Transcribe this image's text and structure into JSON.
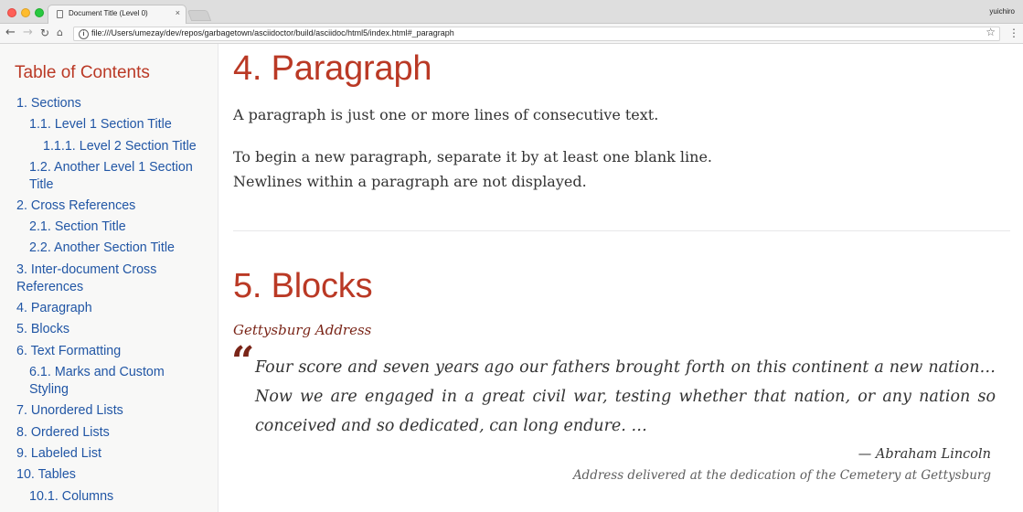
{
  "browser": {
    "tab_title": "Document Title (Level 0)",
    "tab_close": "×",
    "profile_name": "yuichiro",
    "url": "file:///Users/umezay/dev/repos/garbagetown/asciidoctor/build/asciidoc/html5/index.html#_paragraph",
    "icons": {
      "back": "←",
      "forward": "→",
      "reload": "↻",
      "home": "⌂",
      "info": "i",
      "star": "☆",
      "menu": "⋮"
    }
  },
  "toc": {
    "title": "Table of Contents",
    "items": [
      {
        "label": "1. Sections",
        "level": 1
      },
      {
        "label": "1.1. Level 1 Section Title",
        "level": 2
      },
      {
        "label": "1.1.1. Level 2 Section Title",
        "level": 3
      },
      {
        "label": "1.2. Another Level 1 Section Title",
        "level": 2
      },
      {
        "label": "2. Cross References",
        "level": 1
      },
      {
        "label": "2.1. Section Title",
        "level": 2
      },
      {
        "label": "2.2. Another Section Title",
        "level": 2
      },
      {
        "label": "3. Inter-document Cross References",
        "level": 1
      },
      {
        "label": "4. Paragraph",
        "level": 1
      },
      {
        "label": "5. Blocks",
        "level": 1
      },
      {
        "label": "6. Text Formatting",
        "level": 1
      },
      {
        "label": "6.1. Marks and Custom Styling",
        "level": 2
      },
      {
        "label": "7. Unordered Lists",
        "level": 1
      },
      {
        "label": "8. Ordered Lists",
        "level": 1
      },
      {
        "label": "9. Labeled List",
        "level": 1
      },
      {
        "label": "10. Tables",
        "level": 1
      },
      {
        "label": "10.1. Columns",
        "level": 2
      }
    ]
  },
  "content": {
    "section4": {
      "heading": "4. Paragraph",
      "para1": "A paragraph is just one or more lines of consecutive text.",
      "para2_line1": "To begin a new paragraph, separate it by at least one blank line.",
      "para2_line2": "Newlines within a paragraph are not displayed."
    },
    "section5": {
      "heading": "5. Blocks",
      "quote_title": "Gettysburg Address",
      "quote_mark": "“",
      "quote_text": "Four score and seven years ago our fathers brought forth on this continent a new nation… Now we are engaged in a great civil war, testing whether that nation, or any nation so conceived and so dedicated, can long endure. …",
      "attribution": "— Abraham Lincoln",
      "cite_title": "Address delivered at the dedication of the Cemetery at Gettysburg"
    }
  },
  "colors": {
    "heading": "#ba3925",
    "link": "#2156a5",
    "quote_accent": "#7a2518",
    "body_text": "#333333",
    "toc_background": "#f8f8f7"
  }
}
